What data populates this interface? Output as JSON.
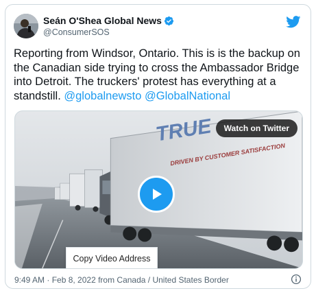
{
  "author": {
    "name": "Seán O'Shea Global News",
    "handle": "@ConsumerSOS",
    "verified": true
  },
  "tweet": {
    "text": "Reporting from Windsor, Ontario. This is is the backup on the Canadian side trying to cross the Ambassador Bridge into Detroit. The truckers' protest has everything at a standstill.",
    "mentions": [
      "@globalnewsto",
      "@GlobalNational"
    ]
  },
  "media": {
    "watch_label": "Watch on Twitter",
    "copy_label": "Copy Video Address",
    "trailer_brand": "TRUE",
    "trailer_slogan": "DRIVEN BY CUSTOMER SATISFACTION"
  },
  "footer": {
    "meta": "9:49 AM · Feb 8, 2022 from Canada / United States Border"
  },
  "colors": {
    "accent": "#1d9bf0",
    "text": "#0f1419",
    "muted": "#536471",
    "border": "#cfd9de"
  },
  "icons": {
    "brand": "twitter-bird-icon",
    "verified": "verified-badge-icon",
    "play": "play-icon",
    "info": "info-icon"
  }
}
